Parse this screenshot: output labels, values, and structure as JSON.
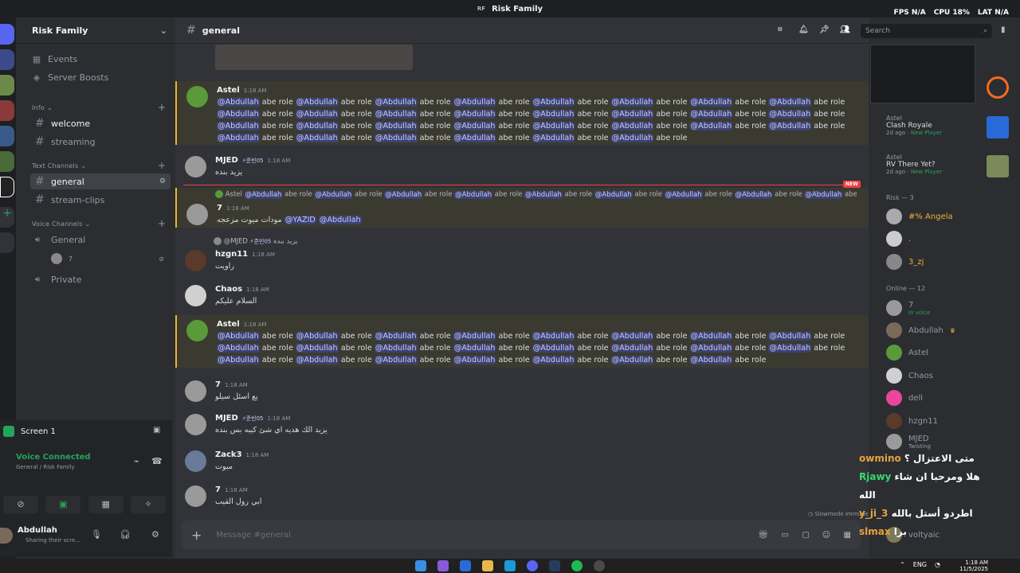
{
  "window": {
    "title": "Risk Family",
    "badge": "RF"
  },
  "perf": {
    "fps_label": "FPS",
    "fps": "N/A",
    "cpu_label": "CPU",
    "cpu": "18%",
    "lat_label": "LAT",
    "lat": "N/A"
  },
  "guild": {
    "name": "Risk Family"
  },
  "sidebar": {
    "events": "Events",
    "boosts": "Server Boosts",
    "info_category": "Info",
    "info_channels": [
      "welcome",
      "streaming"
    ],
    "text_category": "Text Channels",
    "text_channels": [
      "general",
      "stream-clips"
    ],
    "voice_category": "Voice Channels",
    "voice_channels": [
      "General",
      "Private"
    ],
    "voice_user": "7"
  },
  "panel": {
    "screen": "Screen 1",
    "voice_status": "Voice Connected",
    "voice_sub": "General / Risk Family",
    "username": "Abdullah",
    "user_status": "Sharing their scre..."
  },
  "chat": {
    "channel": "general",
    "mention": "@Abdullah",
    "role_text": "abe role",
    "new_badge": "NEW",
    "composer_placeholder": "Message #general",
    "slowmode": "Slowmode Immune",
    "messages": [
      {
        "author": "Astel",
        "time": "1:18 AM",
        "tag": ""
      },
      {
        "author": "MJED",
        "time": "1:18 AM",
        "tag": "⚡준빈05",
        "text": "يزيد بنده"
      },
      {
        "reply_author": "Astel",
        "author": "7",
        "time": "1:18 AM",
        "text": "مودات ميوت مزعجه",
        "m1": "@YAZID",
        "m2": "@Abdullah"
      },
      {
        "reply_author": "@MJED",
        "reply_tag": "⚡준빈05",
        "reply_text": "يزيد بنده",
        "author": "hzgn11",
        "time": "1:18 AM",
        "text": "راويت"
      },
      {
        "author": "Chaos",
        "time": "1:18 AM",
        "text": "السلام عليكم"
      },
      {
        "author": "Astel",
        "time": "1:18 AM"
      },
      {
        "author": "7",
        "time": "1:18 AM",
        "text": "يع اسئل سيلو"
      },
      {
        "author": "MJED",
        "time": "1:18 AM",
        "tag": "⚡준빈05",
        "text": "يزيد الك هديه اي شئ كيبه بس بنده"
      },
      {
        "author": "Zack3",
        "time": "1:18 AM",
        "text": "ميوت"
      },
      {
        "author": "7",
        "time": "1:18 AM",
        "text": "ابي رول القيب"
      }
    ]
  },
  "right": {
    "search_placeholder": "Search",
    "activities": [
      {
        "user": "Astel",
        "game": "Clash Royale",
        "when": "2d ago",
        "label": "New Player"
      },
      {
        "user": "Astel",
        "game": "RV There Yet?",
        "when": "2d ago",
        "label": "New Player"
      }
    ],
    "risk_header": "Risk — 3",
    "risk_members": [
      "#% Angela",
      ".",
      "3_zj"
    ],
    "online_header": "Online — 12",
    "online_members": [
      {
        "name": "7",
        "sub": "In voice"
      },
      {
        "name": "Abdullah",
        "sub": ""
      },
      {
        "name": "Astel",
        "sub": ""
      },
      {
        "name": "Chaos",
        "sub": ""
      },
      {
        "name": "dell",
        "sub": ""
      },
      {
        "name": "hzgn11",
        "sub": ""
      },
      {
        "name": "MJED",
        "sub": "Twisting"
      },
      {
        "name": "voltyaic",
        "sub": ""
      }
    ]
  },
  "overlay": [
    {
      "user": "owmino",
      "text": "متى الاعتزال ؟"
    },
    {
      "user": "Rjawy",
      "text": "هلا ومرحبا ان شاء الله"
    },
    {
      "user": "y_ji_3",
      "text": "اطردو أستل بالله"
    },
    {
      "user": "slmax",
      "text": "برا"
    }
  ],
  "taskbar": {
    "lang": "ENG",
    "time": "1:18 AM",
    "date": "11/5/2025"
  },
  "colors": {
    "accent": "#5865f2",
    "mention_bg": "#3c4270",
    "highlight": "#f0b132",
    "online": "#23a55a",
    "overlay_user": "#e8a33b"
  }
}
